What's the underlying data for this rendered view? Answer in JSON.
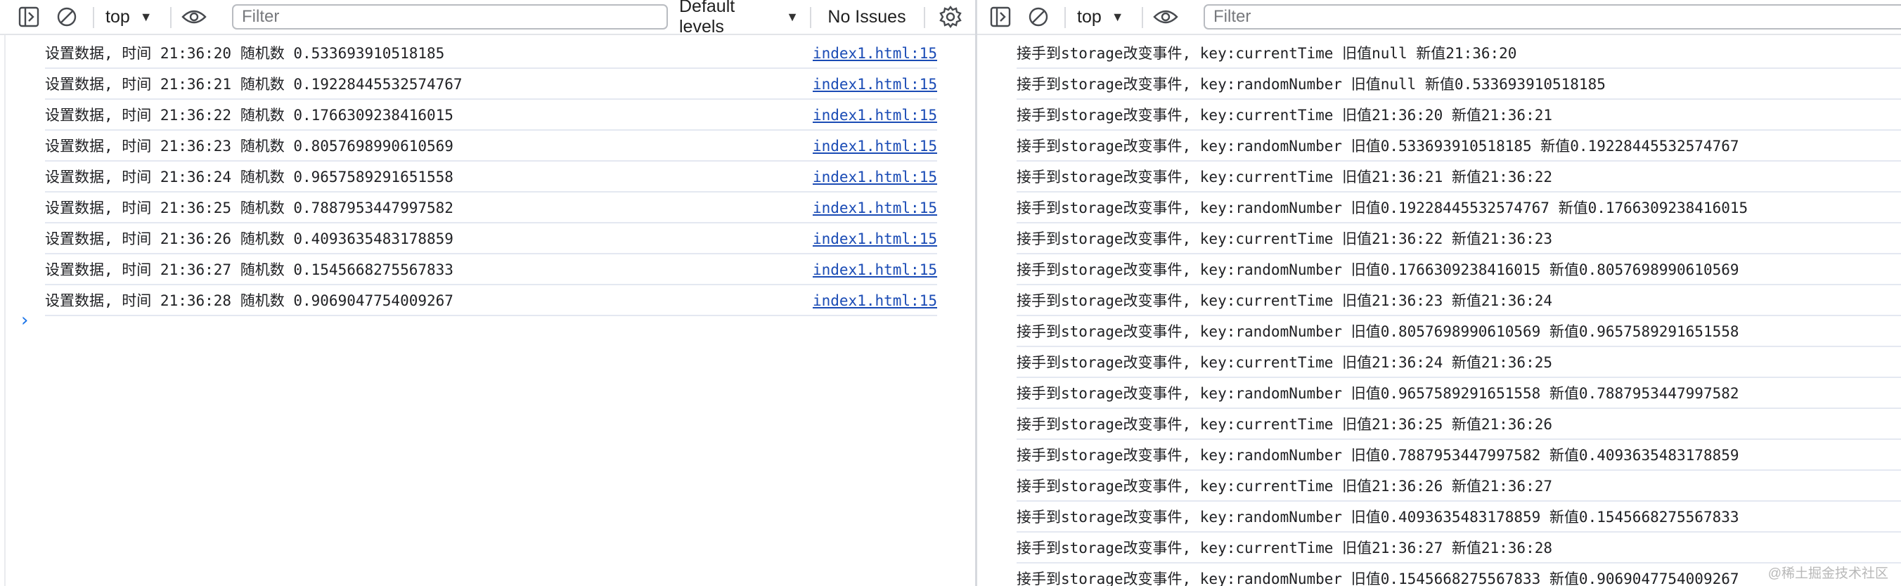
{
  "left": {
    "toolbar": {
      "sidebar_icon": "sidebar-toggle-icon",
      "clear_icon": "clear-console-icon",
      "context": "top",
      "eye_icon": "live-expression-icon",
      "filter_placeholder": "Filter",
      "levels": "Default levels",
      "issues": "No Issues",
      "settings_icon": "gear-icon"
    },
    "logs": [
      {
        "text": "设置数据, 时间 21:36:20 随机数 0.533693910518185",
        "source": "index1.html:15"
      },
      {
        "text": "设置数据, 时间 21:36:21 随机数 0.19228445532574767",
        "source": "index1.html:15"
      },
      {
        "text": "设置数据, 时间 21:36:22 随机数 0.1766309238416015",
        "source": "index1.html:15"
      },
      {
        "text": "设置数据, 时间 21:36:23 随机数 0.8057698990610569",
        "source": "index1.html:15"
      },
      {
        "text": "设置数据, 时间 21:36:24 随机数 0.9657589291651558",
        "source": "index1.html:15"
      },
      {
        "text": "设置数据, 时间 21:36:25 随机数 0.7887953447997582",
        "source": "index1.html:15"
      },
      {
        "text": "设置数据, 时间 21:36:26 随机数 0.4093635483178859",
        "source": "index1.html:15"
      },
      {
        "text": "设置数据, 时间 21:36:27 随机数 0.1545668275567833",
        "source": "index1.html:15"
      },
      {
        "text": "设置数据, 时间 21:36:28 随机数 0.9069047754009267",
        "source": "index1.html:15"
      }
    ],
    "prompt": "›"
  },
  "right": {
    "toolbar": {
      "sidebar_icon": "sidebar-toggle-icon",
      "clear_icon": "clear-console-icon",
      "context": "top",
      "eye_icon": "live-expression-icon",
      "filter_placeholder": "Filter"
    },
    "logs": [
      "接手到storage改变事件, key:currentTime 旧值null 新值21:36:20",
      "接手到storage改变事件, key:randomNumber 旧值null 新值0.533693910518185",
      "接手到storage改变事件, key:currentTime 旧值21:36:20 新值21:36:21",
      "接手到storage改变事件, key:randomNumber 旧值0.533693910518185 新值0.19228445532574767",
      "接手到storage改变事件, key:currentTime 旧值21:36:21 新值21:36:22",
      "接手到storage改变事件, key:randomNumber 旧值0.19228445532574767 新值0.1766309238416015",
      "接手到storage改变事件, key:currentTime 旧值21:36:22 新值21:36:23",
      "接手到storage改变事件, key:randomNumber 旧值0.1766309238416015 新值0.8057698990610569",
      "接手到storage改变事件, key:currentTime 旧值21:36:23 新值21:36:24",
      "接手到storage改变事件, key:randomNumber 旧值0.8057698990610569 新值0.9657589291651558",
      "接手到storage改变事件, key:currentTime 旧值21:36:24 新值21:36:25",
      "接手到storage改变事件, key:randomNumber 旧值0.9657589291651558 新值0.7887953447997582",
      "接手到storage改变事件, key:currentTime 旧值21:36:25 新值21:36:26",
      "接手到storage改变事件, key:randomNumber 旧值0.7887953447997582 新值0.4093635483178859",
      "接手到storage改变事件, key:currentTime 旧值21:36:26 新值21:36:27",
      "接手到storage改变事件, key:randomNumber 旧值0.4093635483178859 新值0.1545668275567833",
      "接手到storage改变事件, key:currentTime 旧值21:36:27 新值21:36:28",
      "接手到storage改变事件, key:randomNumber 旧值0.1545668275567833 新值0.9069047754009267"
    ]
  },
  "watermark": "@稀土掘金技术社区",
  "colors": {
    "link": "#1a4bb5",
    "prompt": "#1a73e8",
    "row_border": "#e4e8f1"
  }
}
